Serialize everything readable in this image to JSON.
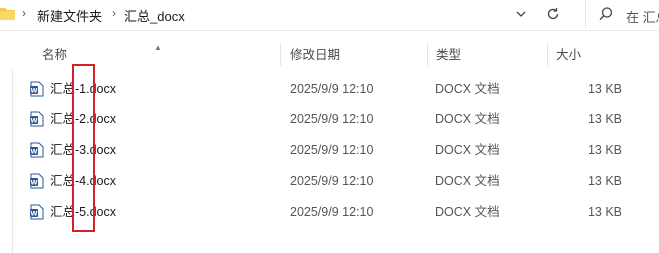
{
  "address_bar": {
    "breadcrumbs": [
      "新建文件夹",
      "汇总_docx"
    ],
    "dropdown_icon": "chevron-down-icon",
    "refresh_icon": "refresh-icon"
  },
  "search": {
    "placeholder": "在 汇总"
  },
  "columns": {
    "name": "名称",
    "date": "修改日期",
    "type": "类型",
    "size": "大小"
  },
  "files": [
    {
      "name": "汇总-1.docx",
      "date": "2025/9/9 12:10",
      "type": "DOCX 文档",
      "size": "13 KB"
    },
    {
      "name": "汇总-2.docx",
      "date": "2025/9/9 12:10",
      "type": "DOCX 文档",
      "size": "13 KB"
    },
    {
      "name": "汇总-3.docx",
      "date": "2025/9/9 12:10",
      "type": "DOCX 文档",
      "size": "13 KB"
    },
    {
      "name": "汇总-4.docx",
      "date": "2025/9/9 12:10",
      "type": "DOCX 文档",
      "size": "13 KB"
    },
    {
      "name": "汇总-5.docx",
      "date": "2025/9/9 12:10",
      "type": "DOCX 文档",
      "size": "13 KB"
    }
  ],
  "colors": {
    "highlight": "#d2232a",
    "word_blue": "#2b5797",
    "folder": "#f2c94c"
  }
}
